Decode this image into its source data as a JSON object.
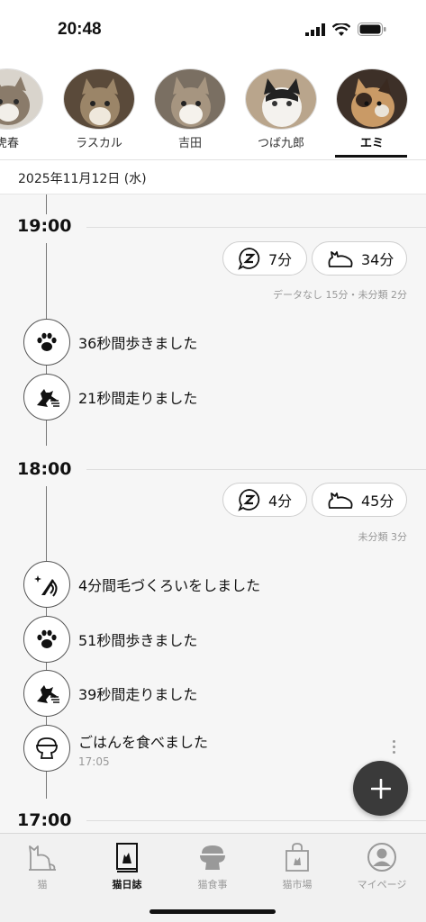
{
  "status_bar": {
    "time": "20:48"
  },
  "cats": [
    {
      "name": "虎春",
      "active": false
    },
    {
      "name": "ラスカル",
      "active": false
    },
    {
      "name": "吉田",
      "active": false
    },
    {
      "name": "つば九郎",
      "active": false
    },
    {
      "name": "エミ",
      "active": true
    }
  ],
  "date": "2025年11月12日 (水)",
  "hours": [
    {
      "label": "19:00",
      "sleep": "7分",
      "rest": "34分",
      "note": "データなし 15分・未分類 2分",
      "events": [
        {
          "icon": "paw-icon",
          "text": "36秒間歩きました"
        },
        {
          "icon": "running-cat-icon",
          "text": "21秒間走りました"
        }
      ]
    },
    {
      "label": "18:00",
      "sleep": "4分",
      "rest": "45分",
      "note": "未分類 3分",
      "events": [
        {
          "icon": "grooming-icon",
          "text": "4分間毛づくろいをしました"
        },
        {
          "icon": "paw-icon",
          "text": "51秒間歩きました"
        },
        {
          "icon": "running-cat-icon",
          "text": "39秒間走りました"
        },
        {
          "icon": "food-bowl-icon",
          "text": "ごはんを食べました",
          "sub": "17:05"
        }
      ]
    },
    {
      "label": "17:00"
    }
  ],
  "nav": [
    {
      "label": "猫",
      "icon": "cat-icon",
      "active": false
    },
    {
      "label": "猫日誌",
      "icon": "diary-icon",
      "active": true
    },
    {
      "label": "猫食事",
      "icon": "food-icon",
      "active": false
    },
    {
      "label": "猫市場",
      "icon": "shopping-bag-icon",
      "active": false
    },
    {
      "label": "マイページ",
      "icon": "profile-icon",
      "active": false
    }
  ],
  "colors": {
    "accent": "#111111",
    "fab": "#3a3a3a",
    "inactive": "#999999"
  }
}
